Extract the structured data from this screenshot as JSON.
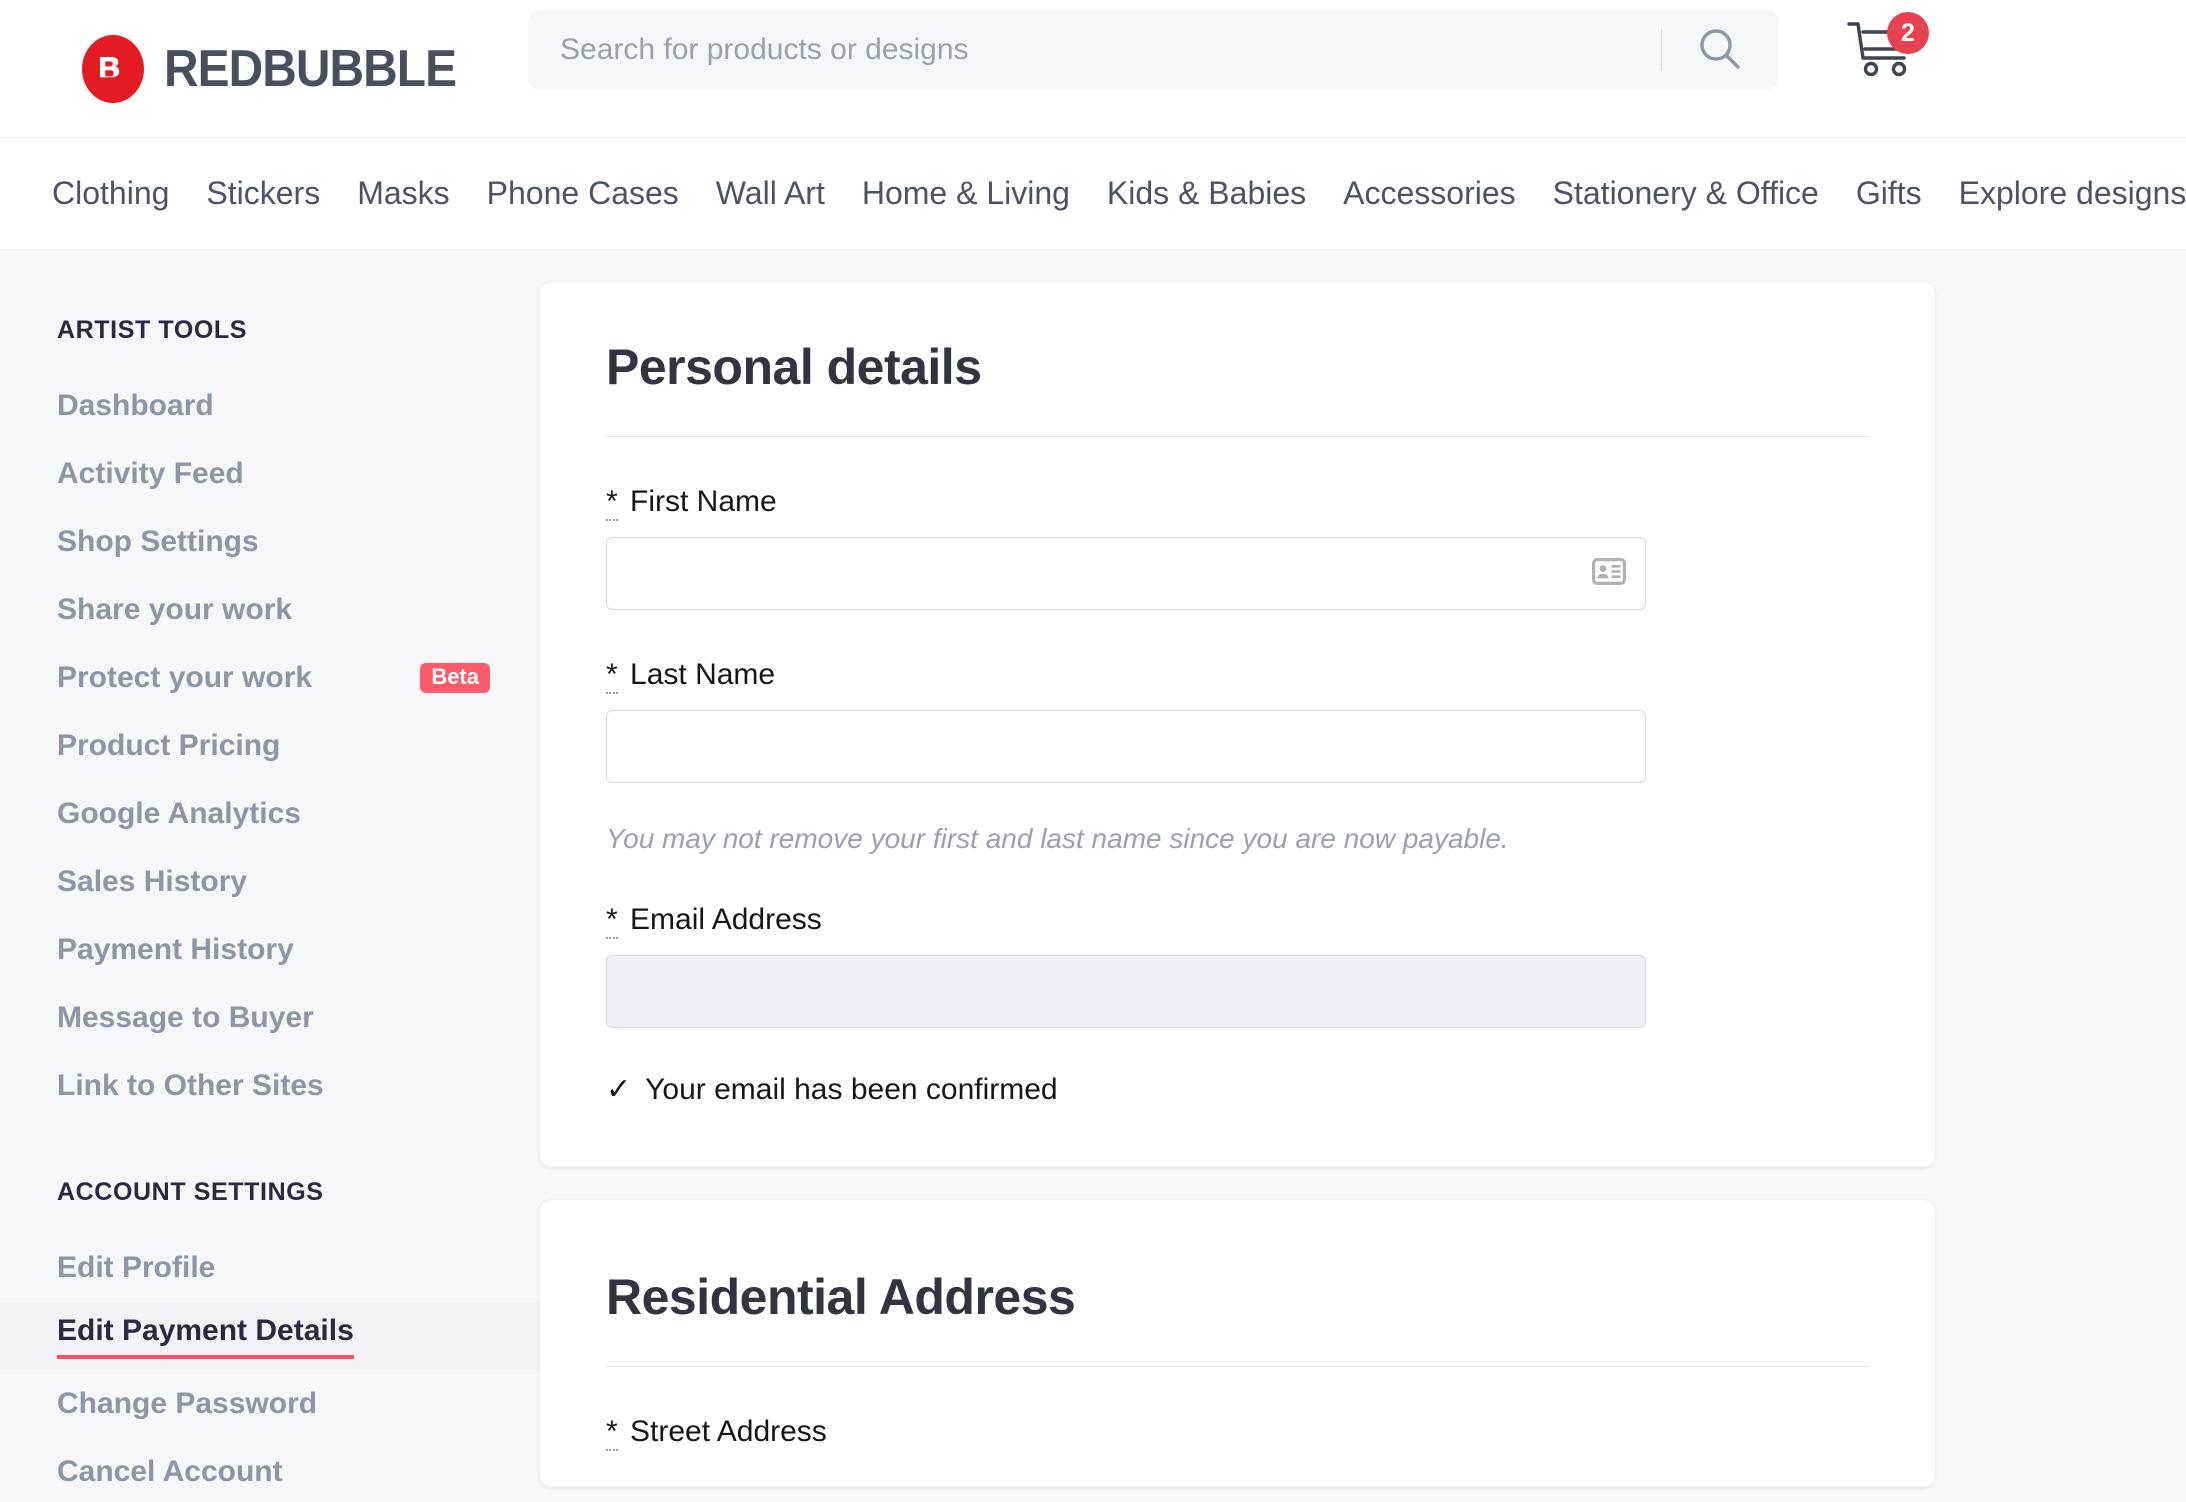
{
  "brand": {
    "name": "REDBUBBLE",
    "logo_icon": "redbubble-logo-icon",
    "logo_color": "#e41b23"
  },
  "search": {
    "placeholder": "Search for products or designs",
    "value": "",
    "icon": "search-icon"
  },
  "cart": {
    "icon": "shopping-cart-icon",
    "count": "2",
    "badge_color": "#e8414f"
  },
  "category_nav": {
    "items": [
      {
        "label": "Clothing"
      },
      {
        "label": "Stickers"
      },
      {
        "label": "Masks"
      },
      {
        "label": "Phone Cases"
      },
      {
        "label": "Wall Art"
      },
      {
        "label": "Home & Living"
      },
      {
        "label": "Kids & Babies"
      },
      {
        "label": "Accessories"
      },
      {
        "label": "Stationery & Office"
      },
      {
        "label": "Gifts"
      },
      {
        "label": "Explore designs"
      }
    ]
  },
  "sidebar": {
    "artist_tools_heading": "ARTIST TOOLS",
    "artist_tools": [
      {
        "label": "Dashboard",
        "badge": ""
      },
      {
        "label": "Activity Feed",
        "badge": ""
      },
      {
        "label": "Shop Settings",
        "badge": ""
      },
      {
        "label": "Share your work",
        "badge": ""
      },
      {
        "label": "Protect your work",
        "badge": "Beta"
      },
      {
        "label": "Product Pricing",
        "badge": ""
      },
      {
        "label": "Google Analytics",
        "badge": ""
      },
      {
        "label": "Sales History",
        "badge": ""
      },
      {
        "label": "Payment History",
        "badge": ""
      },
      {
        "label": "Message to Buyer",
        "badge": ""
      },
      {
        "label": "Link to Other Sites",
        "badge": ""
      }
    ],
    "account_settings_heading": "ACCOUNT SETTINGS",
    "account_settings": [
      {
        "label": "Edit Profile",
        "active": false
      },
      {
        "label": "Edit Payment Details",
        "active": true
      },
      {
        "label": "Change Password",
        "active": false
      },
      {
        "label": "Cancel Account",
        "active": false
      }
    ],
    "active_underline_color": "#f55266",
    "beta_badge_color": "#ff5a6b"
  },
  "personal_details": {
    "title": "Personal details",
    "required_marker": "*",
    "first_name": {
      "label": "First Name",
      "value": "",
      "icon": "contact-card-icon"
    },
    "last_name": {
      "label": "Last Name",
      "value": ""
    },
    "name_helper": "You may not remove your first and last name since you are now payable.",
    "email": {
      "label": "Email Address",
      "value": "",
      "disabled": true
    },
    "email_confirmed_check": "✓",
    "email_confirmed_text": "Your email has been confirmed"
  },
  "residential_address": {
    "title": "Residential Address",
    "required_marker": "*",
    "street_address": {
      "label": "Street Address",
      "value": ""
    }
  }
}
